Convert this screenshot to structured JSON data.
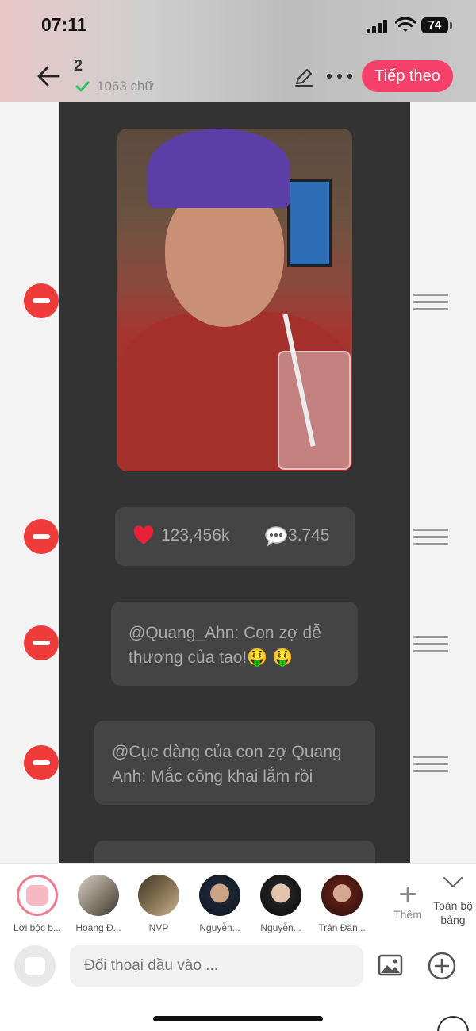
{
  "status_bar": {
    "time": "07:11",
    "battery": "74"
  },
  "header": {
    "doc_number": "2",
    "word_count": "1063 chữ",
    "next_label": "Tiếp theo"
  },
  "stats": {
    "likes": "123,456k",
    "comments": "3.745"
  },
  "comments": [
    {
      "text": "@Quang_Ahn: Con zợ dễ thương của tao!🤑 🤑"
    },
    {
      "text": "@Cục dàng của con zợ Quang Anh: Mắc công khai lắm rồi"
    }
  ],
  "characters": [
    {
      "name": "Lời bộc b..."
    },
    {
      "name": "Hoàng Đ..."
    },
    {
      "name": "NVP"
    },
    {
      "name": "Nguyễn..."
    },
    {
      "name": "Nguyễn..."
    },
    {
      "name": "Trần Đăn..."
    }
  ],
  "add_label": "Thêm",
  "all_label": "Toàn bộ bảng",
  "input": {
    "placeholder": "Đối thoại đầu vào ..."
  },
  "colors": {
    "accent": "#f5416a",
    "delete": "#f03b3b",
    "dark_panel": "#333333"
  },
  "icons": [
    "back-arrow-icon",
    "check-icon",
    "pencil-icon",
    "more-icon",
    "minus-icon",
    "drag-handle-icon",
    "heart-icon",
    "speech-bubble-icon",
    "plus-icon",
    "chevron-down-icon",
    "chat-icon",
    "image-icon",
    "add-circle-icon"
  ]
}
